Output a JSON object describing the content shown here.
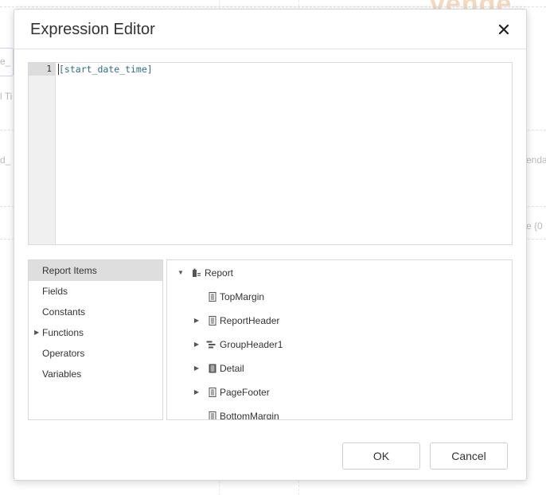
{
  "dialog": {
    "title": "Expression Editor"
  },
  "editor": {
    "line_number": "1",
    "code": "[start_date_time]"
  },
  "categories": [
    {
      "label": "Report Items",
      "selected": true,
      "expandable": false
    },
    {
      "label": "Fields",
      "selected": false,
      "expandable": false
    },
    {
      "label": "Constants",
      "selected": false,
      "expandable": false
    },
    {
      "label": "Functions",
      "selected": false,
      "expandable": true
    },
    {
      "label": "Operators",
      "selected": false,
      "expandable": false
    },
    {
      "label": "Variables",
      "selected": false,
      "expandable": false
    }
  ],
  "tree": {
    "root": {
      "label": "Report",
      "icon": "report-icon",
      "expanded": true
    },
    "children": [
      {
        "label": "TopMargin",
        "icon": "band-icon",
        "expandable": false
      },
      {
        "label": "ReportHeader",
        "icon": "band-icon",
        "expandable": true
      },
      {
        "label": "GroupHeader1",
        "icon": "group-header-icon",
        "expandable": true
      },
      {
        "label": "Detail",
        "icon": "detail-band-icon",
        "expandable": true
      },
      {
        "label": "PageFooter",
        "icon": "band-icon",
        "expandable": true
      },
      {
        "label": "BottomMargin",
        "icon": "band-icon",
        "expandable": false
      }
    ]
  },
  "buttons": {
    "ok": "OK",
    "cancel": "Cancel"
  },
  "background": {
    "brand_fragment": "vende",
    "fragments": [
      "e_",
      "l Ti",
      "d_",
      "enda",
      "e {0"
    ]
  },
  "colors": {
    "code_text": "#2f6f88",
    "selected_category_bg": "#dedede",
    "brand_faded": "#f5d9bf"
  }
}
